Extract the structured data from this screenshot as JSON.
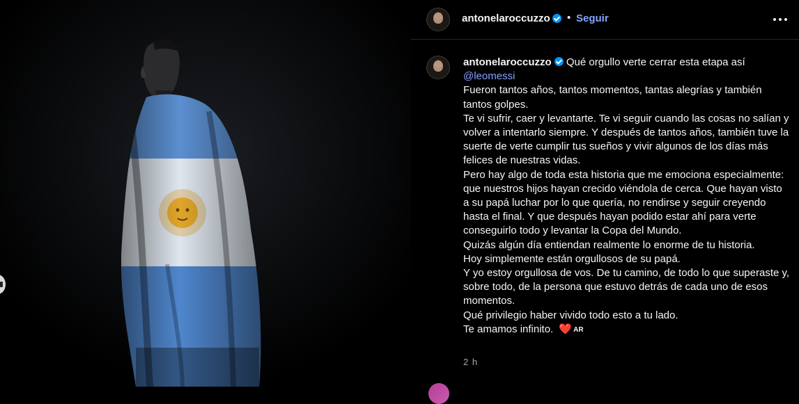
{
  "post": {
    "username": "antonelaroccuzzo",
    "follow_label": "Seguir",
    "separator": "•",
    "caption": {
      "intro": "Qué orgullo verte cerrar esta etapa así",
      "mention": "@leomessi",
      "lines": [
        "Fueron tantos años, tantos momentos, tantas alegrías y también tantos golpes.",
        "Te vi sufrir, caer y levantarte. Te vi seguir cuando las cosas no salían y volver a intentarlo siempre. Y después de tantos años, también tuve la suerte de verte cumplir tus sueños y vivir algunos de los días más felices de nuestras vidas.",
        "Pero hay algo de toda esta historia que me emociona especialmente: que nuestros hijos hayan crecido viéndola de cerca. Que hayan visto a su papá luchar por lo que quería, no rendirse y seguir creyendo hasta el final. Y que después hayan podido estar ahí para verte conseguirlo todo y levantar la Copa del Mundo.",
        "Quizás algún día entiendan realmente lo enorme de tu historia.",
        "Hoy simplemente están orgullosos de su papá.",
        "Y yo estoy orgullosa de vos. De tu camino, de todo lo que superaste y, sobre todo, de la persona que estuvo detrás de cada uno de esos momentos.",
        "Qué privilegio haber vivido todo esto a tu lado."
      ],
      "last_line": "Te amamos infinito.",
      "heart": "❤️",
      "flag_label": "AR"
    },
    "timestamp": "2 h"
  },
  "colors": {
    "accent_link": "#85a3ff",
    "verified": "#0095f6",
    "flag_blue": "#5b8fd0",
    "sun": "#e0a62a"
  },
  "icons": {
    "verified": "verified-badge-icon",
    "more": "more-options-icon",
    "heart": "red-heart-icon"
  }
}
